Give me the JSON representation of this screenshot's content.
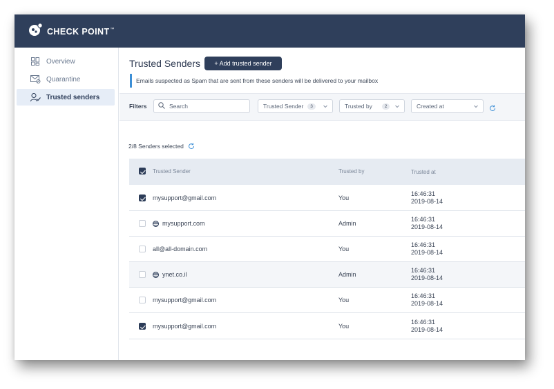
{
  "app": {
    "brand": "CHECK POINT",
    "trademark": "™"
  },
  "sidebar": {
    "items": [
      {
        "label": "Overview",
        "icon": "overview-grid-icon",
        "active": false
      },
      {
        "label": "Quarantine",
        "icon": "quarantine-mail-icon",
        "active": false
      },
      {
        "label": "Trusted senders",
        "icon": "trusted-user-icon",
        "active": true
      }
    ]
  },
  "page": {
    "title": "Trusted Senders",
    "add_button": "+ Add trusted sender",
    "notice": "Emails suspected as Spam that are sent from these senders will be delivered to your mailbox"
  },
  "filters": {
    "label": "Filters",
    "search_placeholder": "Search",
    "dropdowns": [
      {
        "label": "Trusted Sender",
        "count": "3"
      },
      {
        "label": "Trusted by",
        "count": "2"
      },
      {
        "label": "Created at"
      }
    ]
  },
  "selection": {
    "text": "2/8 Senders selected"
  },
  "table": {
    "columns": [
      "Trusted Sender",
      "Trusted by",
      "Trusted at"
    ],
    "header_checked": true,
    "rows": [
      {
        "sender": "mysupport@gmail.com",
        "domain": false,
        "trusted_by": "You",
        "time": "16:46:31",
        "date": "2019-08-14",
        "checked": true,
        "highlight": false
      },
      {
        "sender": "mysupport.com",
        "domain": true,
        "trusted_by": "Admin",
        "time": "16:46:31",
        "date": "2019-08-14",
        "checked": false,
        "highlight": false
      },
      {
        "sender": "all@all-domain.com",
        "domain": false,
        "trusted_by": "You",
        "time": "16:46:31",
        "date": "2019-08-14",
        "checked": false,
        "highlight": false
      },
      {
        "sender": "ynet.co.il",
        "domain": true,
        "trusted_by": "Admin",
        "time": "16:46:31",
        "date": "2019-08-14",
        "checked": false,
        "highlight": true
      },
      {
        "sender": "mysupport@gmail.com",
        "domain": false,
        "trusted_by": "You",
        "time": "16:46:31",
        "date": "2019-08-14",
        "checked": false,
        "highlight": false
      },
      {
        "sender": "mysupport@gmail.com",
        "domain": false,
        "trusted_by": "You",
        "time": "16:46:31",
        "date": "2019-08-14",
        "checked": true,
        "highlight": false
      }
    ]
  },
  "colors": {
    "topbar": "#2f3f5b",
    "accent": "#3d8fd6",
    "active_nav": "#e6edf7"
  }
}
